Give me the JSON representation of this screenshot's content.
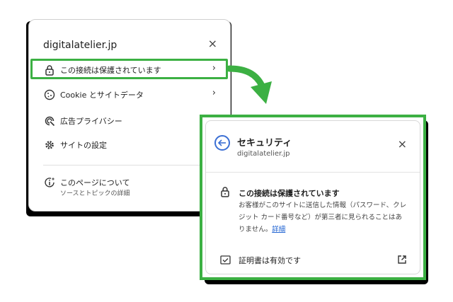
{
  "site_menu": {
    "domain": "digitalatelier.jp",
    "close_label": "×",
    "items": [
      {
        "label": "この接続は保護されています",
        "icon": "lock-icon",
        "chevron": "›"
      },
      {
        "label": "Cookie とサイトデータ",
        "icon": "cookie-icon",
        "chevron": "›"
      },
      {
        "label": "広告プライバシー",
        "icon": "ad-privacy-icon"
      },
      {
        "label": "サイトの設定",
        "icon": "gear-icon"
      }
    ],
    "about": {
      "label": "このページについて",
      "sub": "ソースとトピックの詳細",
      "icon": "info-sparkle-icon"
    }
  },
  "security_panel": {
    "title": "セキュリティ",
    "domain": "digitalatelier.jp",
    "close_label": "×",
    "heading": "この接続は保護されています",
    "body": "お客様がこのサイトに送信した情報（パスワード、クレジット カード番号など）が第三者に見られることはありません。",
    "link": "詳細",
    "cert_label": "証明書は有効です"
  },
  "colors": {
    "highlight": "#3cb043",
    "accent_blue": "#3b6fd4",
    "link": "#1a5fd1"
  }
}
